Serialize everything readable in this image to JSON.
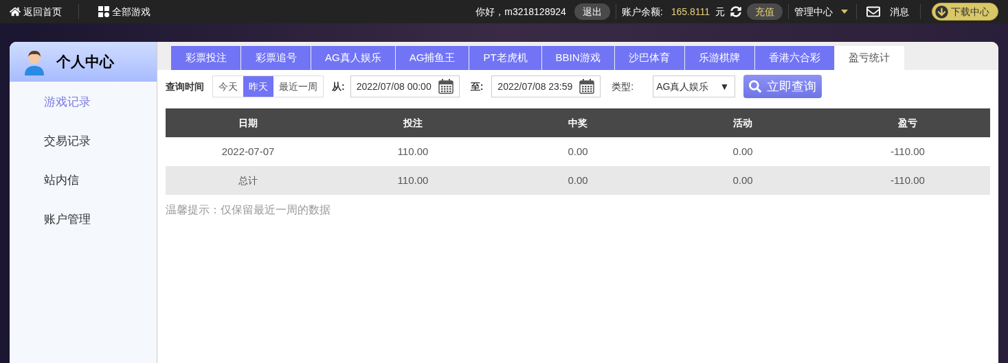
{
  "topbar": {
    "home": "返回首页",
    "all_games": "全部游戏",
    "greeting": "你好，m3218128924",
    "logout": "退出",
    "balance_label": "账户余额:",
    "balance": "165.8111",
    "currency": "元",
    "recharge": "充值",
    "manage": "管理中心",
    "messages": "消息",
    "download": "下载中心"
  },
  "sidebar": {
    "title": "个人中心",
    "items": [
      {
        "label": "游戏记录",
        "selected": true
      },
      {
        "label": "交易记录",
        "selected": false
      },
      {
        "label": "站内信",
        "selected": false
      },
      {
        "label": "账户管理",
        "selected": false
      }
    ]
  },
  "tabs": [
    {
      "label": "彩票投注",
      "selected": false
    },
    {
      "label": "彩票追号",
      "selected": false
    },
    {
      "label": "AG真人娱乐",
      "selected": false
    },
    {
      "label": "AG捕鱼王",
      "selected": false
    },
    {
      "label": "PT老虎机",
      "selected": false
    },
    {
      "label": "BBIN游戏",
      "selected": false
    },
    {
      "label": "沙巴体育",
      "selected": false
    },
    {
      "label": "乐游棋牌",
      "selected": false
    },
    {
      "label": "香港六合彩",
      "selected": false
    },
    {
      "label": "盈亏统计",
      "selected": true
    }
  ],
  "filter": {
    "time_label": "查询时间",
    "ranges": [
      {
        "label": "今天",
        "selected": false
      },
      {
        "label": "昨天",
        "selected": true
      },
      {
        "label": "最近一周",
        "selected": false
      }
    ],
    "from_label": "从:",
    "from": "2022/07/08 00:00",
    "to_label": "至:",
    "to": "2022/07/08 23:59",
    "type_label": "类型:",
    "type": "AG真人娱乐",
    "type_caret": "▼",
    "search": "立即查询"
  },
  "table": {
    "columns": [
      "日期",
      "投注",
      "中奖",
      "活动",
      "盈亏"
    ],
    "rows": [
      {
        "kind": "data",
        "cells": [
          "2022-07-07",
          "110.00",
          "0.00",
          "0.00",
          "-110.00"
        ]
      },
      {
        "kind": "total",
        "cells": [
          "总计",
          "110.00",
          "0.00",
          "0.00",
          "-110.00"
        ]
      }
    ]
  },
  "note": "温馨提示：仅保留最近一周的数据"
}
